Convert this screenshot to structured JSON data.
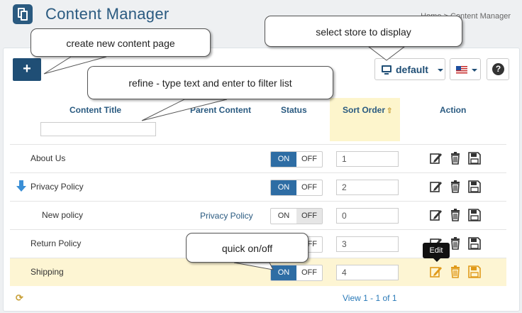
{
  "header": {
    "title": "Content Manager",
    "breadcrumb": "Home > Content Manager"
  },
  "toolbar": {
    "add_label": "+",
    "store_label": "default",
    "help_label": "?"
  },
  "columns": {
    "content_title": "Content Title",
    "parent_content": "Parent Content",
    "status": "Status",
    "sort_order": "Sort Order",
    "action": "Action"
  },
  "toggle": {
    "on": "ON",
    "off": "OFF"
  },
  "rows": [
    {
      "title": "About Us",
      "parent": "",
      "status": "ON",
      "sort": "1"
    },
    {
      "title": "Privacy Policy",
      "parent": "",
      "status": "ON",
      "sort": "2"
    },
    {
      "title": "New policy",
      "parent": "Privacy Policy",
      "status": "OFF",
      "sort": "0"
    },
    {
      "title": "Return Policy",
      "parent": "",
      "status": "ON",
      "sort": "3"
    },
    {
      "title": "Shipping",
      "parent": "",
      "status": "ON",
      "sort": "4"
    }
  ],
  "tooltip": "Edit",
  "pager": "View 1 - 1 of 1",
  "callouts": {
    "create": "create new content page",
    "store": "select store to display",
    "filter": "refine - type text and enter to filter list",
    "toggle": "quick on/off"
  },
  "colors": {
    "accent": "#2a5a80",
    "button": "#1f4e75",
    "toggle_on": "#2e6da4",
    "highlight": "#fdf5d3"
  },
  "icons": [
    "content-page-icon",
    "monitor-icon",
    "us-flag-icon",
    "help-icon",
    "edit-icon",
    "delete-icon",
    "save-icon",
    "down-arrow-icon",
    "refresh-icon",
    "sort-asc-icon"
  ]
}
